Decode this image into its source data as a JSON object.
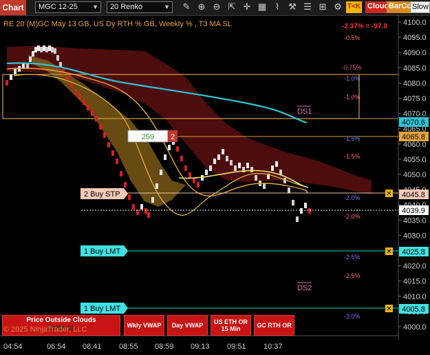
{
  "toolbar": {
    "tab": "Chart",
    "instrument": "MGC 12-25",
    "bartype": "20 Renko",
    "tk_label": "T<K",
    "cloud_label": "Cloud",
    "barcol_label": "BarCol",
    "slowm_label": "SlowM"
  },
  "header": {
    "title": "RE 20  (M)GC May 13 GB, US Dy RTH % GB, Weekly % , T3 MA SL",
    "pnl": "-2.37% = -97.9",
    "pnl_color": "#ff3333"
  },
  "y_axis": {
    "ticks": [
      "4100.0",
      "4095.0",
      "4090.0",
      "4085.0",
      "4080.0",
      "4075.0",
      "4070.0",
      "4065.0",
      "4060.0",
      "4055.0",
      "4050.0",
      "4045.0",
      "4040.0",
      "4035.0",
      "4030.0",
      "4025.0",
      "4020.0",
      "4015.0",
      "4010.0",
      "4005.0",
      "4000.0"
    ],
    "price_tags": {
      "cyan": "4070.6",
      "orange": "4065.8",
      "sell_stop": "4045.8",
      "last": "4039.9",
      "buy_lmt_1": "4025.8",
      "buy_lmt_2": "4005.8"
    }
  },
  "x_axis": {
    "ticks": [
      "04:54",
      "06:54",
      "08:41",
      "08:55",
      "08:59",
      "09:13",
      "09:51",
      "10:37"
    ]
  },
  "pct_labels": [
    "-0.5%",
    "-0.5%",
    "-0.75%",
    "-1.0%",
    "-1.0%",
    "-1.5%",
    "-1.5%",
    "-2.0%",
    "-2.0%",
    "-2.5%",
    "-2.5%",
    "-3.0%"
  ],
  "zones": {
    "ds1": "DS1",
    "ds2": "DS2"
  },
  "orders": {
    "stop_label": "2 Buy STP",
    "buy_lmt_1_label": "1 Buy LMT",
    "buy_lmt_2_label": "1 Buy LMT",
    "position_qty": "259",
    "position_count": "2",
    "close_glyph": "✕"
  },
  "buttons": {
    "price_outside": "Price Outside Clouds",
    "t3_ma_sl": "T3 MA SL",
    "wkly_vwap": "Wkly VWAP",
    "day_vwap": "Day VWAP",
    "us_eth_or": "US ETH OR 15 Min",
    "gc_rth_or": "GC RTH OR"
  },
  "copyright": "© 2025 NinjaTrader, LLC",
  "colors": {
    "cyan_ma": "#2ec4d6",
    "orange": "#e6a33a",
    "cloud_dark": "#5a0f0f",
    "brick_red": "#d42020",
    "brick_white": "#e8e8e8"
  },
  "icons": [
    "pencil-icon",
    "zoom-in-icon",
    "zoom-out-icon",
    "pointer-icon",
    "crosshair-icon",
    "grid-icon",
    "brush-icon",
    "tools-icon"
  ]
}
